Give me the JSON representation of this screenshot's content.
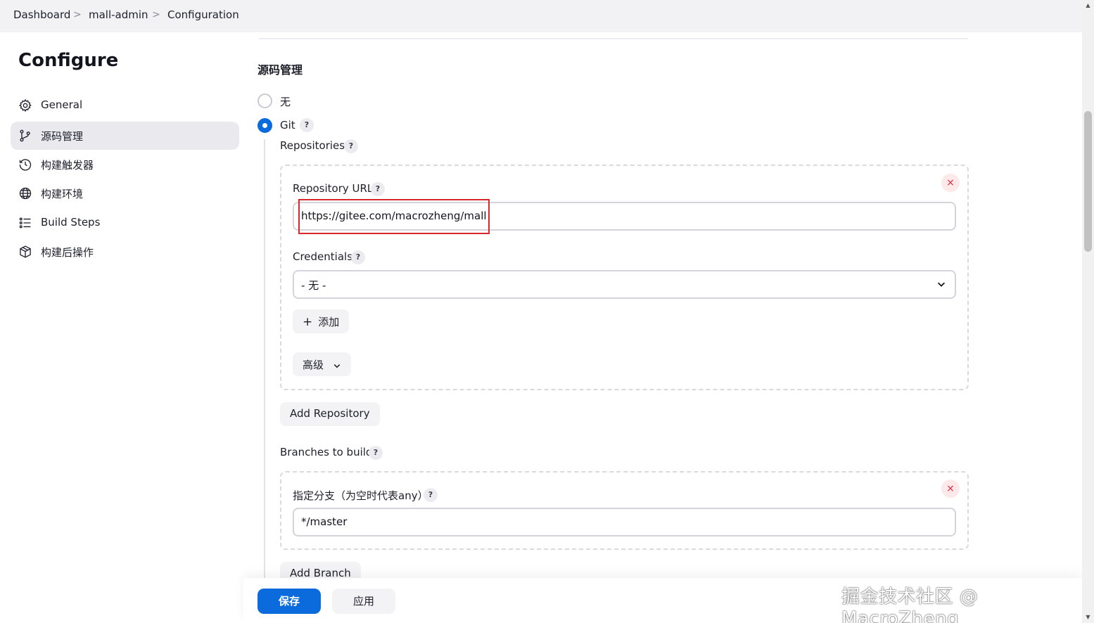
{
  "breadcrumb": {
    "items": [
      "Dashboard",
      "mall-admin",
      "Configuration"
    ],
    "separator": ">"
  },
  "page": {
    "title": "Configure"
  },
  "sidebar": {
    "items": [
      {
        "label": "General",
        "icon": "gear-icon"
      },
      {
        "label": "源码管理",
        "icon": "git-branch-icon",
        "active": true
      },
      {
        "label": "构建触发器",
        "icon": "clock-icon"
      },
      {
        "label": "构建环境",
        "icon": "globe-icon"
      },
      {
        "label": "Build Steps",
        "icon": "list-icon"
      },
      {
        "label": "构建后操作",
        "icon": "package-icon"
      }
    ]
  },
  "scm": {
    "section_title": "源码管理",
    "options": [
      {
        "label": "无",
        "checked": false
      },
      {
        "label": "Git",
        "checked": true
      }
    ],
    "help_glyph": "?",
    "repositories_label": "Repositories",
    "repository_url_label": "Repository URL",
    "repository_url_value": "https://gitee.com/macrozheng/mall",
    "credentials_label": "Credentials",
    "credentials_value": "- 无 -",
    "add_credentials_label": "添加",
    "advanced_label": "高级",
    "add_repository_label": "Add Repository",
    "branches_label": "Branches to build",
    "branch_specifier_label": "指定分支（为空时代表any）",
    "branch_specifier_value": "*/master",
    "add_branch_label": "Add Branch",
    "delete_glyph": "×"
  },
  "actions": {
    "save_label": "保存",
    "apply_label": "应用"
  },
  "watermark": "掘金技术社区 @ MacroZheng",
  "colors": {
    "accent": "#0b6bdc",
    "danger": "#e0253a",
    "highlight": "#d9272e",
    "sidebar_active": "#e9e9ee"
  }
}
